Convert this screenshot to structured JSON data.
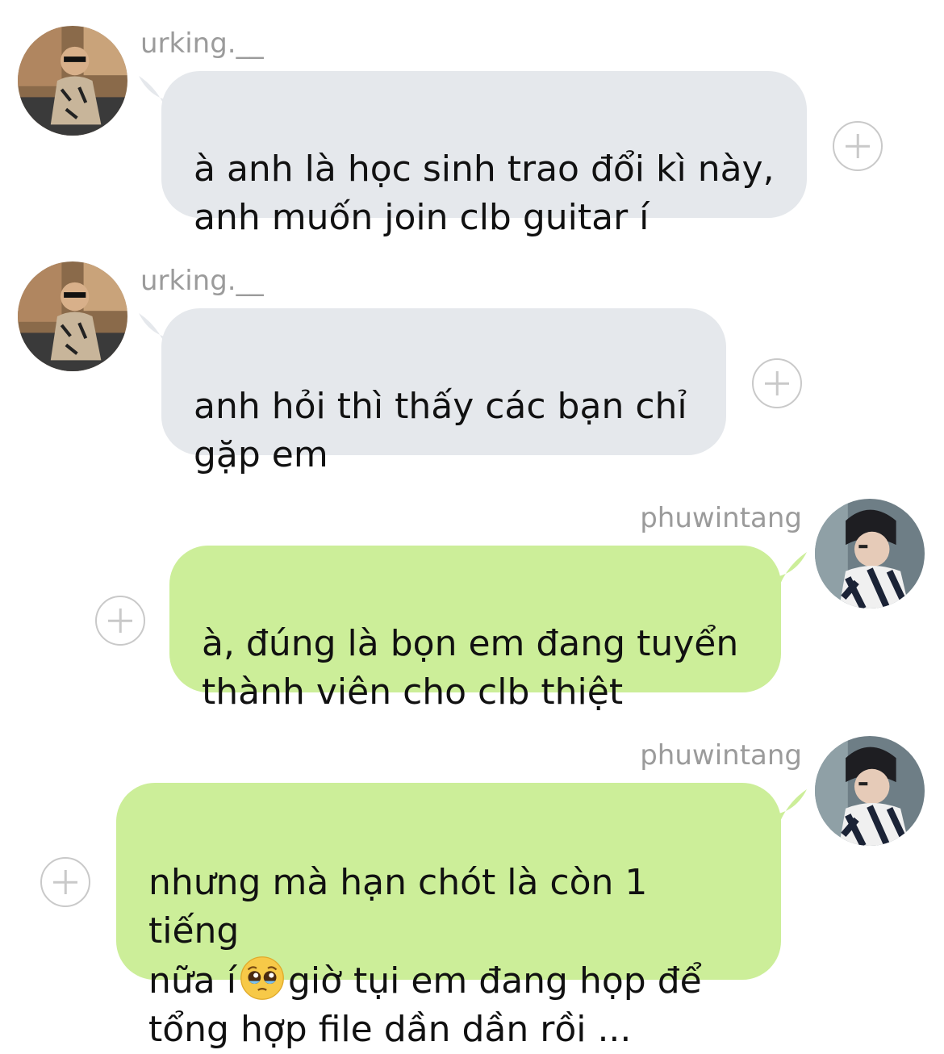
{
  "messages": [
    {
      "sender": "urking.__",
      "direction": "incoming",
      "text": "à anh là học sinh trao đổi kì này,\nanh muốn join clb guitar í"
    },
    {
      "sender": "urking.__",
      "direction": "incoming",
      "text": "anh hỏi thì thấy các bạn chỉ\ngặp em"
    },
    {
      "sender": "phuwintang",
      "direction": "outgoing",
      "text": "à, đúng là bọn em đang tuyển\nthành viên cho clb thiệt"
    },
    {
      "sender": "phuwintang",
      "direction": "outgoing",
      "text_part1": "nhưng mà hạn chót là còn 1 tiếng\nnữa í",
      "emoji": "pleading-face-emoji",
      "text_part2": "giờ tụi em đang họp để\ntổng hợp file dần dần rồi ..."
    }
  ],
  "colors": {
    "incoming_bubble": "#e5e8ec",
    "outgoing_bubble": "#ccee99",
    "username": "#9b9b9b",
    "add_button": "#c9c9c9"
  },
  "icons": {
    "add_reaction": "plus-circle-icon",
    "avatar": "avatar-photo"
  }
}
